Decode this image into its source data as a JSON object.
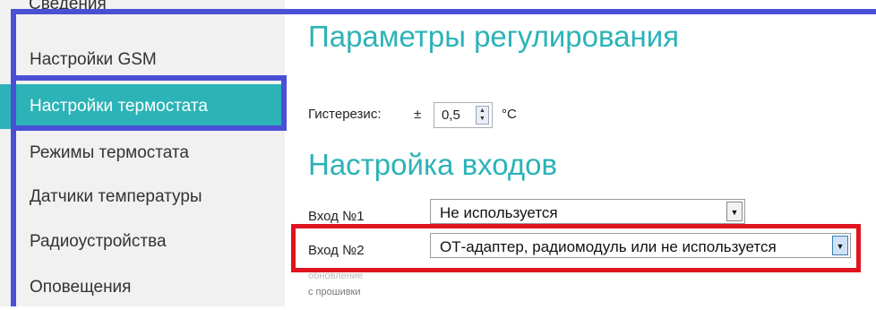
{
  "sidebar": {
    "cut_item": "Сведения",
    "items": [
      {
        "label": "Настройки GSM"
      },
      {
        "label": "Настройки термостата"
      },
      {
        "label": "Режимы термостата"
      },
      {
        "label": "Датчики температуры"
      },
      {
        "label": "Радиоустройства"
      },
      {
        "label": "Оповещения"
      }
    ],
    "active_index": 1
  },
  "main": {
    "params_title": "Параметры регулирования",
    "hysteresis": {
      "label": "Гистерезис:",
      "sign": "±",
      "value": "0,5",
      "unit": "°С"
    },
    "inputs_title": "Настройка входов",
    "input1": {
      "label": "Вход №1",
      "selected": "Не используется"
    },
    "input2": {
      "label": "Вход №2",
      "selected": "ОТ-адаптер, радиомодуль или не используется"
    },
    "footnote_line1": "обновление",
    "footnote_line2": "с прошивки"
  },
  "colors": {
    "accent": "#2bb3b7",
    "highlight_blue": "#4a4fd6",
    "highlight_red": "#e0141e"
  }
}
